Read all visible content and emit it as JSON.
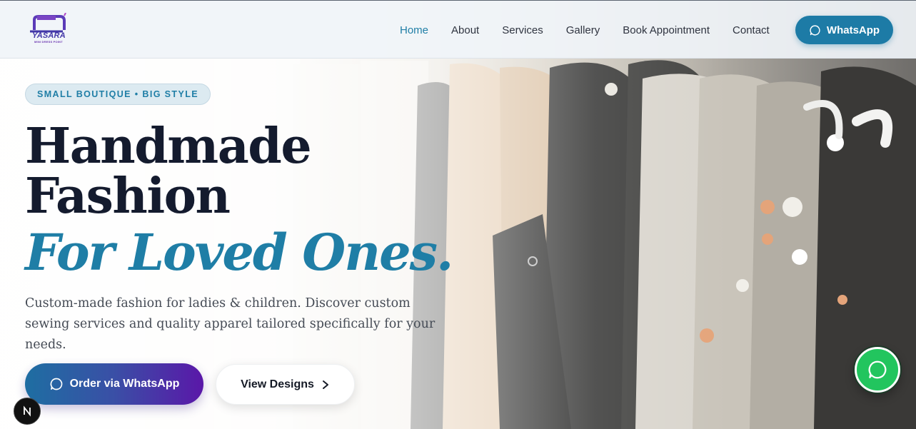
{
  "brand": {
    "name": "YASARA",
    "tagline": "MINI DRESS POINT"
  },
  "nav": {
    "items": [
      {
        "label": "Home",
        "active": true
      },
      {
        "label": "About"
      },
      {
        "label": "Services"
      },
      {
        "label": "Gallery"
      },
      {
        "label": "Book Appointment"
      },
      {
        "label": "Contact"
      }
    ],
    "cta_label": "WhatsApp",
    "cta_icon": "whatsapp-icon"
  },
  "hero": {
    "badge": "SMALL BOUTIQUE • BIG STYLE",
    "headline_line1": "Handmade",
    "headline_line2": "Fashion",
    "headline_accent": "For Loved Ones.",
    "lede": "Custom-made fashion for ladies & children. Discover custom sewing services and quality apparel tailored specifically for your needs.",
    "primary_button": "Order via WhatsApp",
    "secondary_button": "View Designs"
  },
  "floating": {
    "whatsapp_icon": "whatsapp-icon",
    "dev_badge": "N"
  },
  "colors": {
    "accent": "#1f7ea6",
    "headline": "#141b2e",
    "whatsapp_green": "#22c55e",
    "gradient_start": "#1e6ea2",
    "gradient_end": "#5a17a8"
  }
}
